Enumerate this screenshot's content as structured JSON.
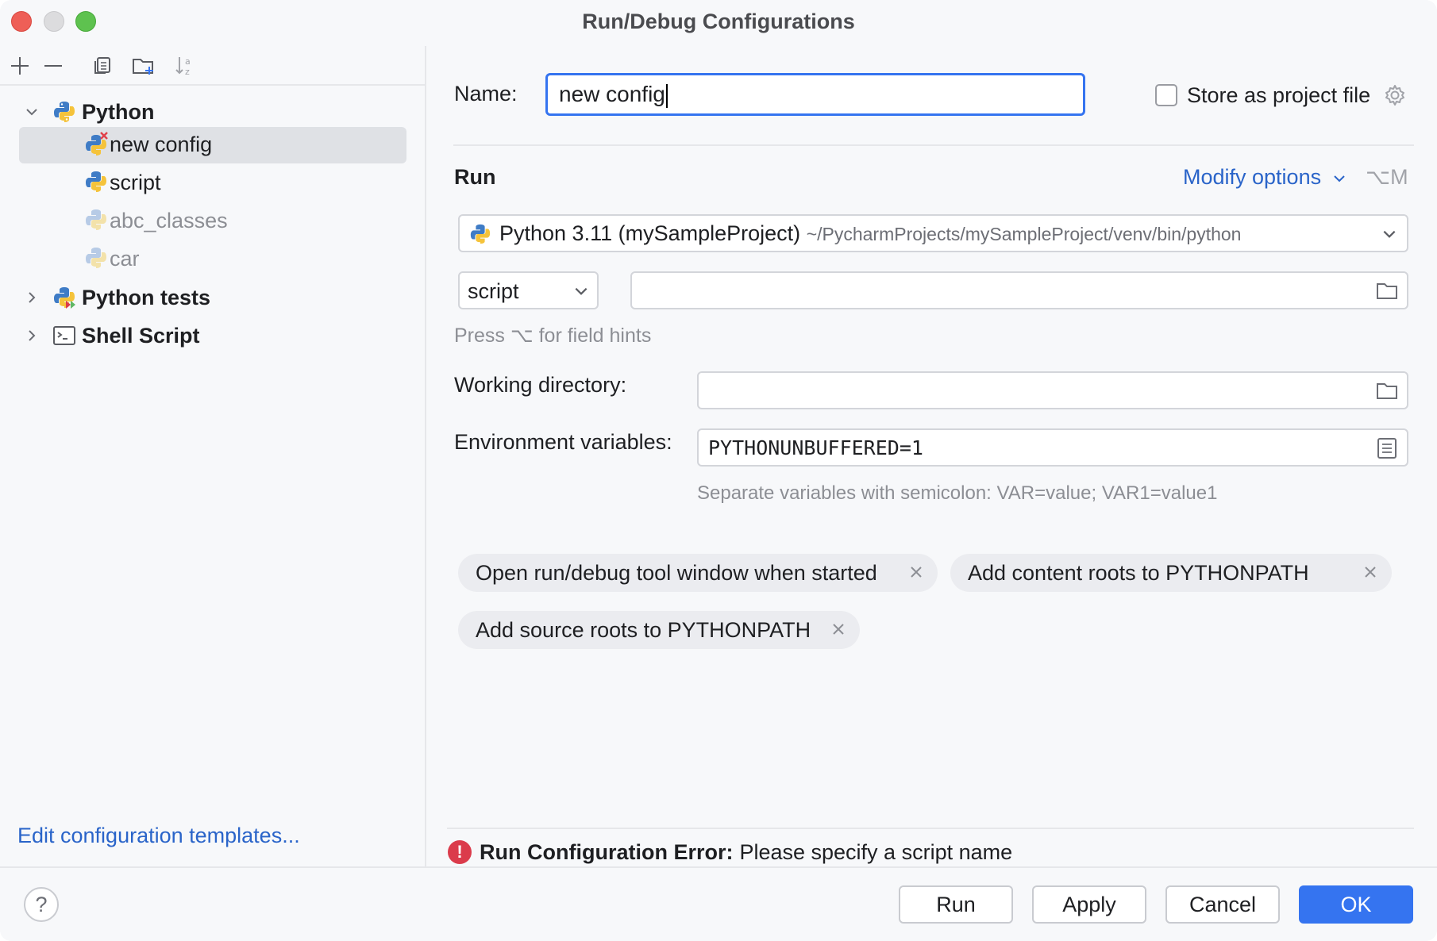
{
  "window": {
    "title": "Run/Debug Configurations"
  },
  "tree": {
    "groups": [
      {
        "label": "Python",
        "children": [
          {
            "label": "new config"
          },
          {
            "label": "script"
          },
          {
            "label": "abc_classes"
          },
          {
            "label": "car"
          }
        ]
      },
      {
        "label": "Python tests"
      },
      {
        "label": "Shell Script"
      }
    ],
    "edit_templates": "Edit configuration templates..."
  },
  "form": {
    "name_label": "Name:",
    "name_value": "new config",
    "store_label": "Store as project file",
    "store_checked": false,
    "run_section": "Run",
    "modify_options": "Modify options",
    "modify_shortcut": "⌥M",
    "interpreter_name": "Python 3.11 (mySampleProject)",
    "interpreter_path": "~/PycharmProjects/mySampleProject/venv/bin/python",
    "script_mode": "script",
    "script_path": "",
    "field_hint": "Press ⌥ for field hints",
    "working_dir_label": "Working directory:",
    "working_dir_value": "",
    "env_label": "Environment variables:",
    "env_value": "PYTHONUNBUFFERED=1",
    "env_hint": "Separate variables with semicolon: VAR=value; VAR1=value1",
    "chips": [
      "Open run/debug tool window when started",
      "Add content roots to PYTHONPATH",
      "Add source roots to PYTHONPATH"
    ],
    "error_title": "Run Configuration Error:",
    "error_message": "Please specify a script name"
  },
  "buttons": {
    "help": "?",
    "run": "Run",
    "apply": "Apply",
    "cancel": "Cancel",
    "ok": "OK"
  },
  "colors": {
    "accent": "#3574f0",
    "link": "#2a64c9",
    "error": "#db3b4b",
    "selection": "#dfe1e5"
  }
}
